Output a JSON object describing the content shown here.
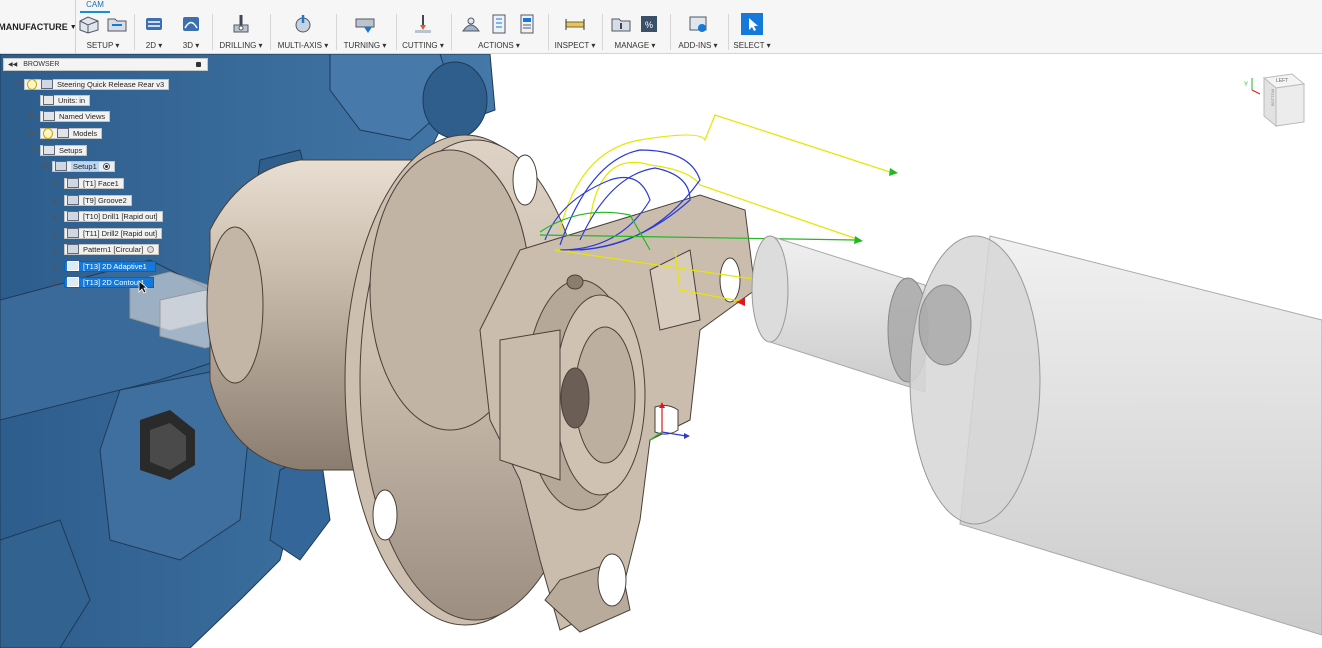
{
  "toolbar": {
    "workspace_label": "MANUFACTURE",
    "active_tab": "CAM",
    "groups": [
      {
        "label": "SETUP ▾",
        "icon": "setup-icon"
      },
      {
        "label": "2D ▾",
        "icon": "2d-milling-icon"
      },
      {
        "label": "3D ▾",
        "icon": "3d-milling-icon"
      },
      {
        "label": "DRILLING ▾",
        "icon": "drilling-icon"
      },
      {
        "label": "MULTI-AXIS ▾",
        "icon": "multi-axis-icon"
      },
      {
        "label": "TURNING ▾",
        "icon": "turning-icon"
      },
      {
        "label": "CUTTING ▾",
        "icon": "cutting-icon"
      },
      {
        "label": "ACTIONS ▾",
        "icon": "actions-icon"
      },
      {
        "label": "INSPECT ▾",
        "icon": "inspect-icon"
      },
      {
        "label": "MANAGE ▾",
        "icon": "manage-icon"
      },
      {
        "label": "ADD-INS ▾",
        "icon": "add-ins-icon"
      },
      {
        "label": "SELECT ▾",
        "icon": "select-icon"
      }
    ]
  },
  "browser": {
    "title": "BROWSER",
    "root": "Steering Quick Release Rear v3",
    "units": "Units: in",
    "named_views": "Named Views",
    "models": "Models",
    "setups": "Setups",
    "setup1": "Setup1",
    "operations": [
      "[T1] Face1",
      "[T9] Groove2",
      "[T10] Drill1 [Rapid out]",
      "[T11] Drill2 [Rapid out]",
      "Pattern1 [Circular]",
      "[T13] 2D Adaptive1",
      "[T13] 2D Contour1"
    ],
    "selected_operations": [
      "[T13] 2D Adaptive1",
      "[T13] 2D Contour1"
    ]
  },
  "viewcube": {
    "face_label": "LEFT",
    "side_label": "BOTTOM"
  },
  "wcs_axes": {
    "x": "X",
    "y": "Y",
    "z": "Z"
  },
  "colors": {
    "accent": "#1479d8",
    "part": "#cfc2b3",
    "fixture": "#3d6e9e",
    "toolpath_yellow": "#e6e600",
    "toolpath_blue": "#2b3bd6",
    "toolpath_green": "#22b822",
    "toolpath_red": "#e01818"
  }
}
